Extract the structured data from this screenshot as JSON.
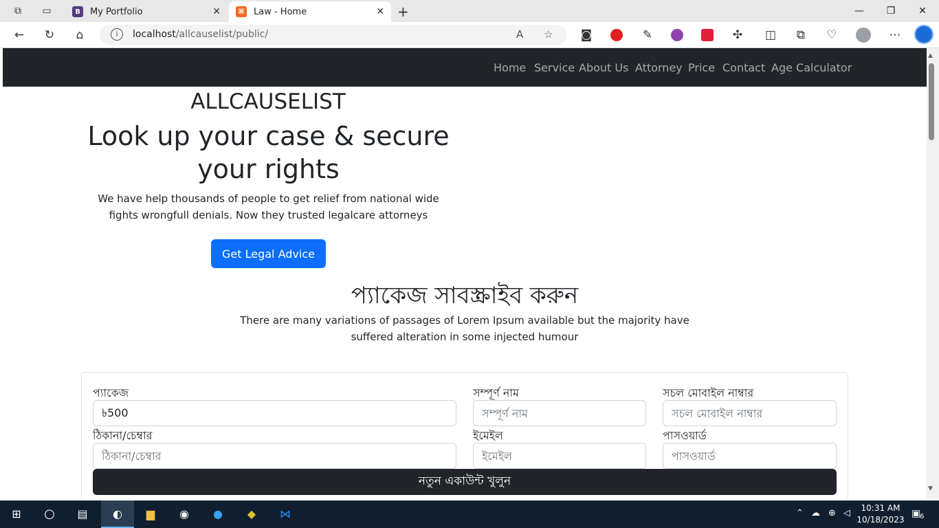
{
  "browser": {
    "tabs": [
      {
        "label": "My Portfolio",
        "favicon_letter": "B",
        "favicon_color": "#563d7c"
      },
      {
        "label": "Law - Home",
        "favicon_letter": "⌘",
        "favicon_color": "#f26b22"
      }
    ],
    "address": {
      "host": "localhost",
      "path": "/allcauselist/public/"
    }
  },
  "nav": {
    "items": [
      "Home",
      "Service",
      "About Us",
      "Attorney",
      "Price",
      "Contact",
      "Age Calculator"
    ]
  },
  "hero": {
    "brand": "ALLCAUSELIST",
    "title": "Look up your case & secure your rights",
    "text": "We have help thousands of people to get relief from national wide fights wrongfull denials. Now they trusted legalcare attorneys",
    "button": "Get Legal Advice"
  },
  "packages": {
    "title": "প্যাকেজ সাবস্ক্রাইব করুন",
    "text": "There are many variations of passages of Lorem Ipsum available but the majority have suffered alteration in some injected humour"
  },
  "form": {
    "package_label": "প্যাকেজ",
    "package_value": "৳500",
    "name_label": "সম্পূর্ণ নাম",
    "name_placeholder": "সম্পূর্ণ নাম",
    "mobile_label": "সচল মোবাইল নাম্বার",
    "mobile_placeholder": "সচল মোবাইল নাম্বার",
    "address_label": "ঠিকানা/চেম্বার",
    "address_placeholder": "ঠিকানা/চেম্বার",
    "email_label": "ইমেইল",
    "email_placeholder": "ইমেইল",
    "password_label": "পাসওয়ার্ড",
    "password_placeholder": "পাসওয়ার্ড",
    "submit": "নতুন একাউন্ট খুলুন"
  },
  "taskbar": {
    "time": "10:31 AM",
    "date": "10/18/2023",
    "notifications": "6"
  },
  "colors": {
    "primary": "#0d6efd",
    "dark": "#212529",
    "taskbar": "#0f1f30"
  }
}
